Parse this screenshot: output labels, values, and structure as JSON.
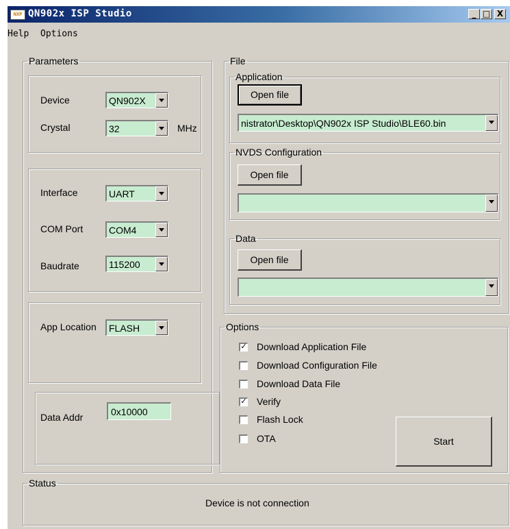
{
  "window": {
    "title": "QN902x ISP Studio",
    "logo_text": "NXP",
    "controls": {
      "minimize": "_",
      "maximize": "□",
      "close": "X"
    }
  },
  "menu": [
    {
      "label": "Help"
    },
    {
      "label": "Options"
    }
  ],
  "parameters": {
    "legend": "Parameters",
    "device": {
      "label": "Device",
      "value": "QN902X"
    },
    "crystal": {
      "label": "Crystal",
      "value": "32",
      "unit": "MHz"
    },
    "interface": {
      "label": "Interface",
      "value": "UART"
    },
    "com_port": {
      "label": "COM Port",
      "value": "COM4"
    },
    "baudrate": {
      "label": "Baudrate",
      "value": "115200"
    },
    "app_location": {
      "label": "App Location",
      "value": "FLASH"
    },
    "data_addr": {
      "label": "Data Addr",
      "value": "0x10000"
    }
  },
  "file": {
    "legend": "File",
    "application": {
      "legend": "Application",
      "button": "Open file",
      "path": "nistrator\\Desktop\\QN902x ISP Studio\\BLE60.bin"
    },
    "nvds": {
      "legend": "NVDS Configuration",
      "button": "Open file",
      "path": ""
    },
    "data": {
      "legend": "Data",
      "button": "Open file",
      "path": ""
    }
  },
  "options": {
    "legend": "Options",
    "items": [
      {
        "label": "Download Application File",
        "checked": true,
        "mark": "✓"
      },
      {
        "label": "Download Configuration File",
        "checked": false,
        "mark": ""
      },
      {
        "label": "Download Data File",
        "checked": false,
        "mark": ""
      },
      {
        "label": "Verify",
        "checked": true,
        "mark": "✓"
      },
      {
        "label": "Flash Lock",
        "checked": false,
        "mark": ""
      },
      {
        "label": "OTA",
        "checked": false,
        "mark": ""
      }
    ],
    "start_button": "Start"
  },
  "status": {
    "legend": "Status",
    "message": "Device is not connection"
  }
}
